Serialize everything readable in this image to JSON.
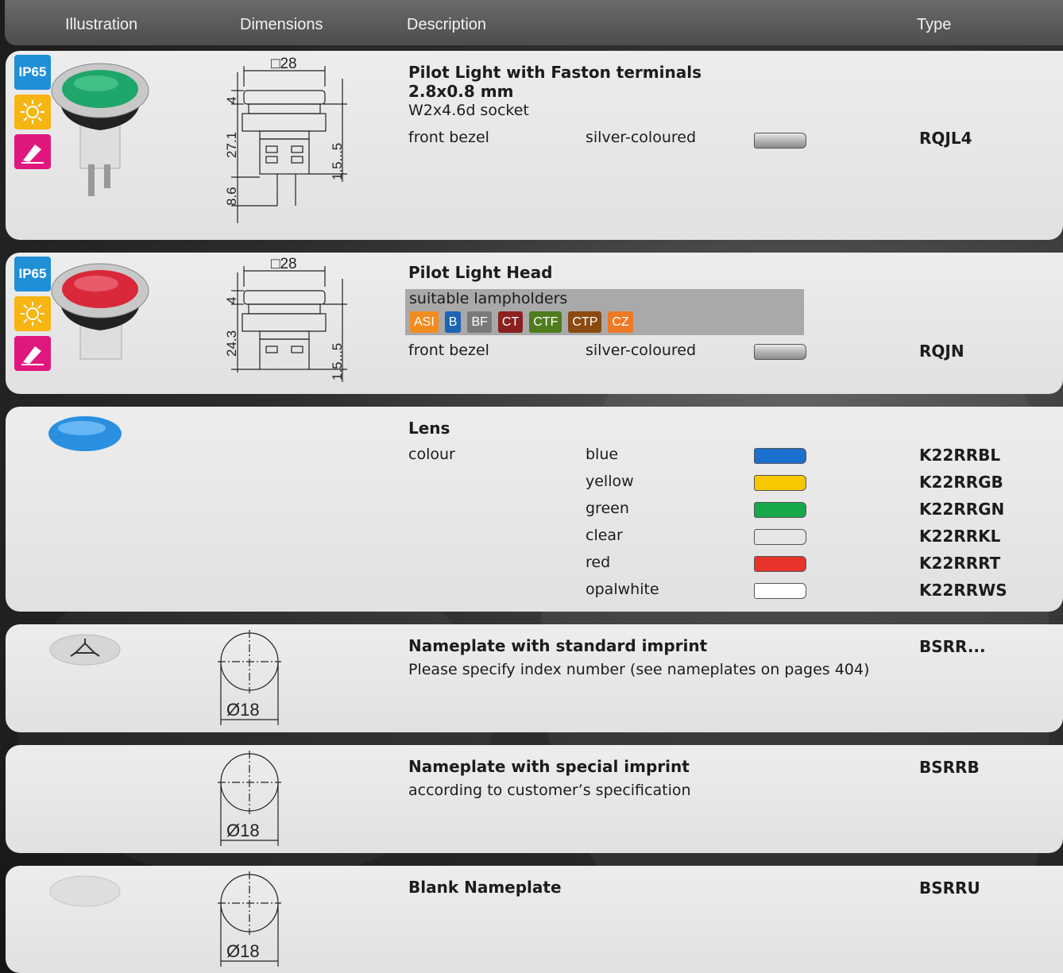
{
  "header": {
    "illustration": "Illustration",
    "dimensions": "Dimensions",
    "description": "Description",
    "type": "Type"
  },
  "icons": {
    "badge_ip": "IP65",
    "sun": "sun-icon",
    "pen": "pen-icon"
  },
  "products": {
    "rqjl4": {
      "title1": "Pilot Light with Faston terminals",
      "title2": "2.8x0.8 mm",
      "subtitle": "W2x4.6d socket",
      "attr_label": "front bezel",
      "attr_value": "silver-coloured",
      "type": "RQJL4",
      "dims": {
        "square": "□28",
        "d1": "4",
        "d2": "27.1",
        "d3": "8.6",
        "d4": "1.5...5"
      }
    },
    "rqjn": {
      "title": "Pilot Light Head",
      "lampholders_label": "suitable lampholders",
      "lampholders": [
        {
          "label": "ASI",
          "color": "#f28c1e"
        },
        {
          "label": "B",
          "color": "#1c64b4"
        },
        {
          "label": "BF",
          "color": "#7a7a7a"
        },
        {
          "label": "CT",
          "color": "#8b2020"
        },
        {
          "label": "CTF",
          "color": "#4f7d1e"
        },
        {
          "label": "CTP",
          "color": "#8a4a12"
        },
        {
          "label": "CZ",
          "color": "#ef7a25"
        }
      ],
      "attr_label": "front bezel",
      "attr_value": "silver-coloured",
      "type": "RQJN",
      "dims": {
        "square": "□28",
        "d1": "4",
        "d2": "24.3",
        "d4": "1.5...5"
      }
    },
    "lens": {
      "title": "Lens",
      "attr_label": "colour",
      "colours": [
        {
          "name": "blue",
          "color": "#1a6fcf",
          "type": "K22RRBL"
        },
        {
          "name": "yellow",
          "color": "#f7c800",
          "type": "K22RRGB"
        },
        {
          "name": "green",
          "color": "#17a84a",
          "type": "K22RRGN"
        },
        {
          "name": "clear",
          "color": "#e6e6e6",
          "type": "K22RRKL"
        },
        {
          "name": "red",
          "color": "#e8332a",
          "type": "K22RRRT"
        },
        {
          "name": "opalwhite",
          "color": "#ffffff",
          "type": "K22RRWS"
        }
      ]
    },
    "np_standard": {
      "title": "Nameplate with standard imprint",
      "desc": "Please specify index number (see nameplates on pages 404)",
      "type": "BSRR...",
      "dim": "Ø18"
    },
    "np_special": {
      "title": "Nameplate with special imprint",
      "desc": "according to customer’s specification",
      "type": "BSRRB",
      "dim": "Ø18"
    },
    "np_blank": {
      "title": "Blank Nameplate",
      "type": "BSRRU",
      "dim": "Ø18"
    }
  },
  "silver_swatch": "#b5b5b5"
}
